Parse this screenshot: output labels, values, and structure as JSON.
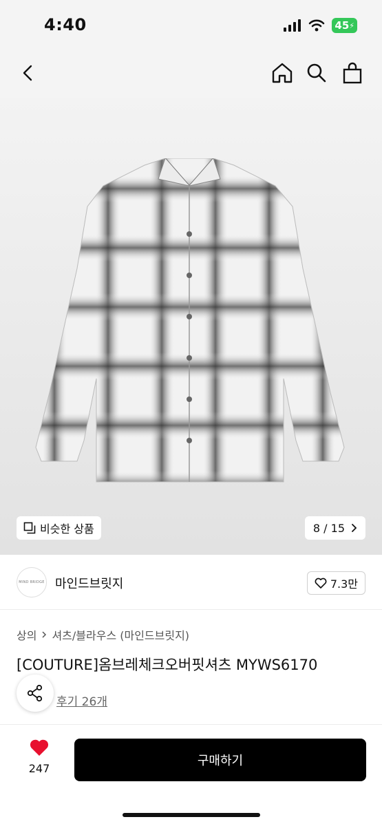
{
  "status_bar": {
    "time": "4:40",
    "battery": "45"
  },
  "nav": {
    "back_icon": "chevron-left-icon",
    "home_icon": "home-icon",
    "search_icon": "search-icon",
    "bag_icon": "shopping-bag-icon"
  },
  "gallery": {
    "similar_label": "비슷한 상품",
    "page_indicator": "8 / 15"
  },
  "brand": {
    "logo_text": "MIND BRIDGE",
    "name": "마인드브릿지",
    "likes": "7.3만"
  },
  "product": {
    "category": [
      "상의",
      "셔츠/블라우스 (마인드브릿지)"
    ],
    "title": "[COUTURE]옴브레체크오버핏셔츠 MYWS6170",
    "reviews": "후기 26개"
  },
  "bottom": {
    "wish_count": "247",
    "buy_label": "구매하기"
  },
  "colors": {
    "accent": "#000000",
    "heart": "#e8102e",
    "battery": "#34c759"
  }
}
